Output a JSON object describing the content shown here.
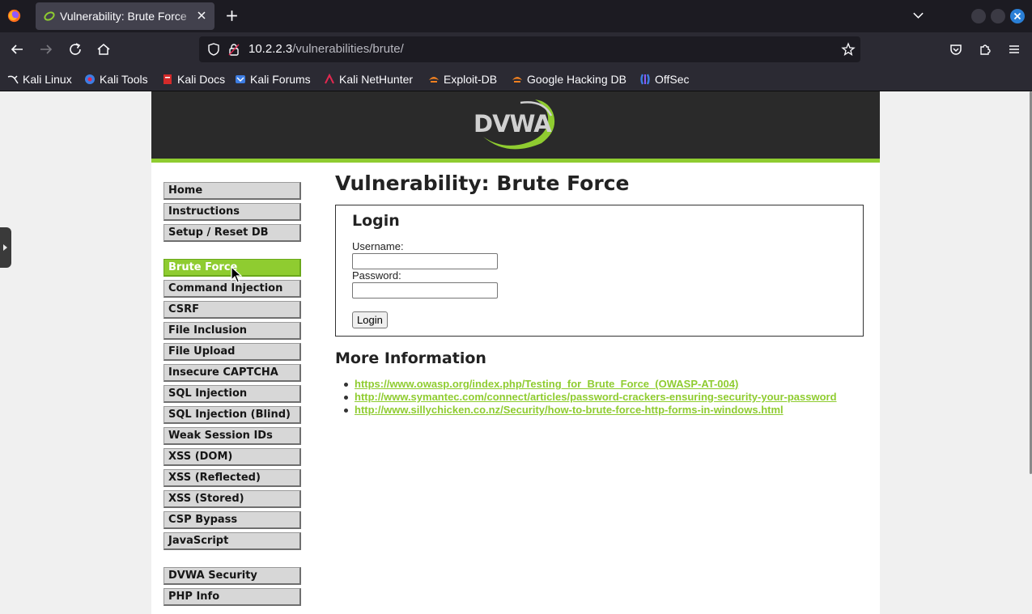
{
  "browser": {
    "tab_title": "Vulnerability: Brute Force",
    "url_host": "10.2.2.3",
    "url_path": "/vulnerabilities/brute/",
    "bookmarks": [
      "Kali Linux",
      "Kali Tools",
      "Kali Docs",
      "Kali Forums",
      "Kali NetHunter",
      "Exploit-DB",
      "Google Hacking DB",
      "OffSec"
    ]
  },
  "header": {
    "logo_text": "DVWA"
  },
  "menu": {
    "group1": [
      "Home",
      "Instructions",
      "Setup / Reset DB"
    ],
    "group2": [
      "Brute Force",
      "Command Injection",
      "CSRF",
      "File Inclusion",
      "File Upload",
      "Insecure CAPTCHA",
      "SQL Injection",
      "SQL Injection (Blind)",
      "Weak Session IDs",
      "XSS (DOM)",
      "XSS (Reflected)",
      "XSS (Stored)",
      "CSP Bypass",
      "JavaScript"
    ],
    "group3": [
      "DVWA Security",
      "PHP Info"
    ],
    "selected": "Brute Force"
  },
  "main": {
    "title": "Vulnerability: Brute Force",
    "login": {
      "title": "Login",
      "username_label": "Username:",
      "username_value": "",
      "password_label": "Password:",
      "password_value": "",
      "button": "Login"
    },
    "more_info_title": "More Information",
    "links": [
      "https://www.owasp.org/index.php/Testing_for_Brute_Force_(OWASP-AT-004)",
      "http://www.symantec.com/connect/articles/password-crackers-ensuring-security-your-password",
      "http://www.sillychicken.co.nz/Security/how-to-brute-force-http-forms-in-windows.html"
    ]
  },
  "colors": {
    "accent": "#8fcc30",
    "header_bg": "#2a2a2a",
    "chrome_bg": "#2b2a33"
  }
}
